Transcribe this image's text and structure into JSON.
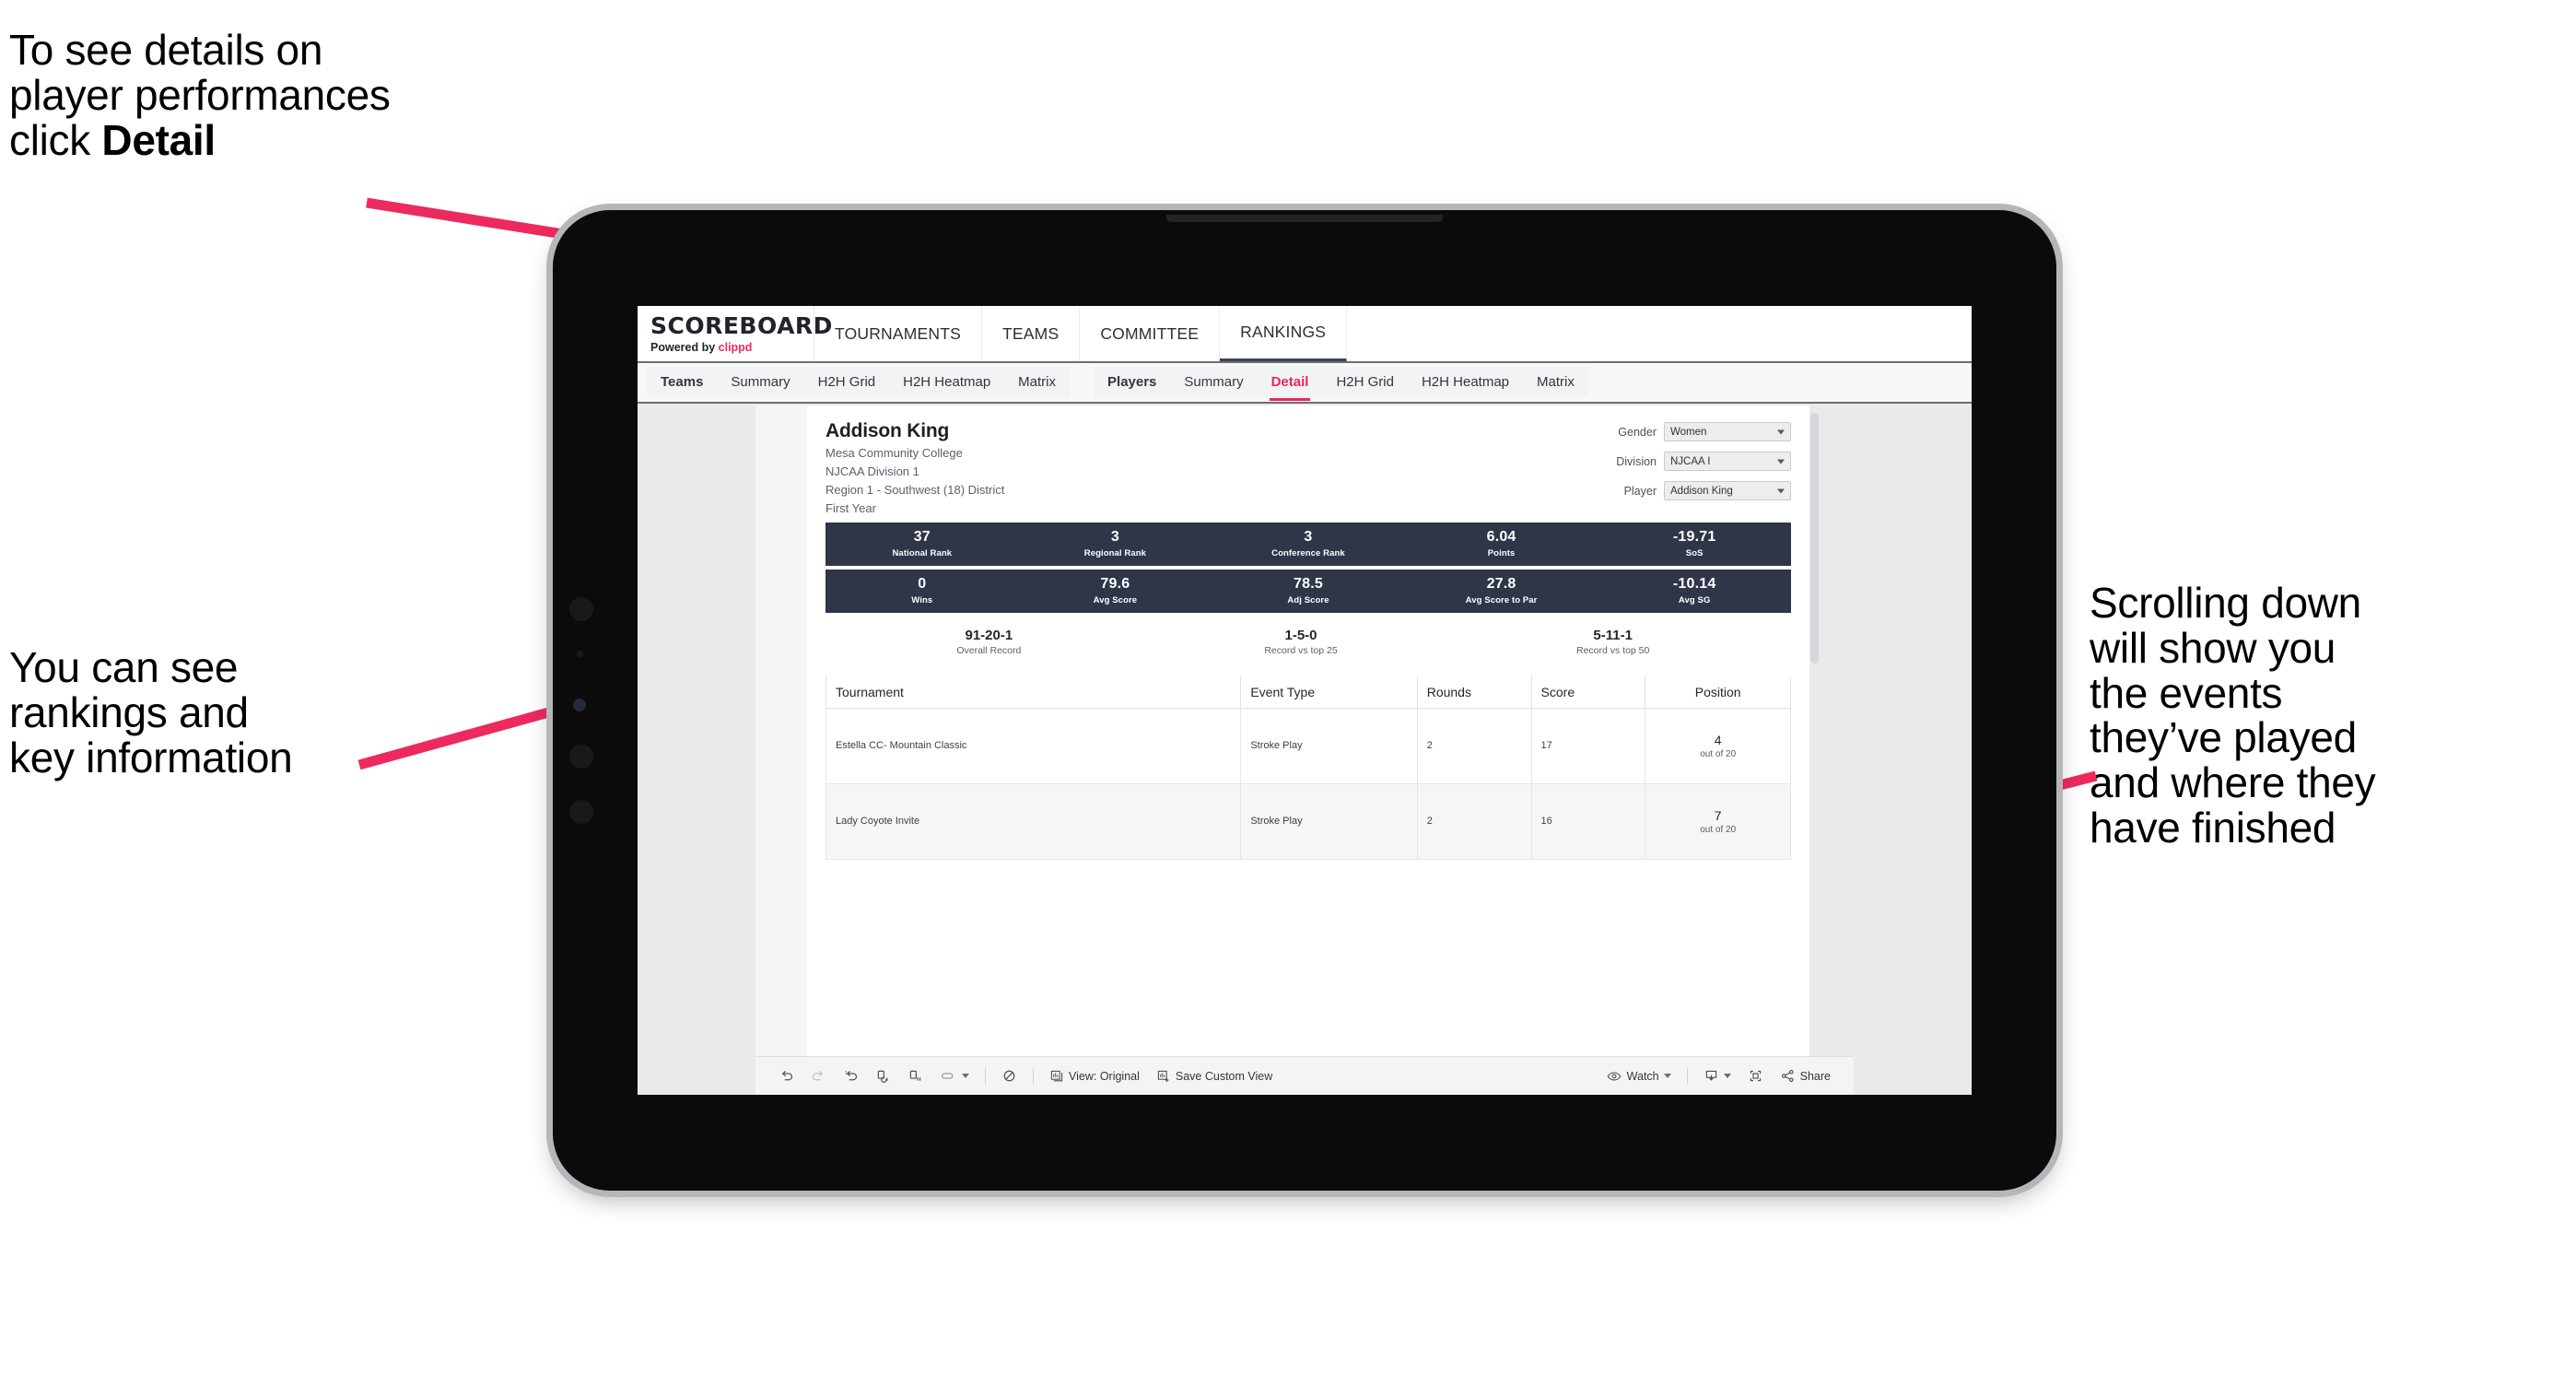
{
  "annotations": {
    "top_left": "To see details on\nplayer performances\nclick ",
    "top_left_bold": "Detail",
    "bottom_left": "You can see\nrankings and\nkey information",
    "right": "Scrolling down\nwill show you\nthe events\nthey’ve played\nand where they\nhave finished"
  },
  "brand": {
    "wordmark": "SCOREBOARD",
    "powered_prefix": "Powered by ",
    "powered_name": "clippd"
  },
  "topnav": [
    {
      "label": "TOURNAMENTS"
    },
    {
      "label": "TEAMS"
    },
    {
      "label": "COMMITTEE"
    },
    {
      "label": "RANKINGS"
    }
  ],
  "subtabs": {
    "teams_group": [
      {
        "label": "Teams",
        "active": false
      },
      {
        "label": "Summary",
        "active": false
      },
      {
        "label": "H2H Grid",
        "active": false
      },
      {
        "label": "H2H Heatmap",
        "active": false
      },
      {
        "label": "Matrix",
        "active": false
      }
    ],
    "players_group": [
      {
        "label": "Players",
        "active": false
      },
      {
        "label": "Summary",
        "active": false
      },
      {
        "label": "Detail",
        "active": true
      },
      {
        "label": "H2H Grid",
        "active": false
      },
      {
        "label": "H2H Heatmap",
        "active": false
      },
      {
        "label": "Matrix",
        "active": false
      }
    ]
  },
  "player": {
    "name": "Addison King",
    "school": "Mesa Community College",
    "division": "NJCAA Division 1",
    "region": "Region 1 - Southwest (18) District",
    "year": "First Year"
  },
  "filters": [
    {
      "label": "Gender",
      "value": "Women"
    },
    {
      "label": "Division",
      "value": "NJCAA I"
    },
    {
      "label": "Player",
      "value": "Addison King"
    }
  ],
  "stats_row_1": [
    {
      "value": "37",
      "label": "National Rank"
    },
    {
      "value": "3",
      "label": "Regional Rank"
    },
    {
      "value": "3",
      "label": "Conference Rank"
    },
    {
      "value": "6.04",
      "label": "Points"
    },
    {
      "value": "-19.71",
      "label": "SoS"
    }
  ],
  "stats_row_2": [
    {
      "value": "0",
      "label": "Wins"
    },
    {
      "value": "79.6",
      "label": "Avg Score"
    },
    {
      "value": "78.5",
      "label": "Adj Score"
    },
    {
      "value": "27.8",
      "label": "Avg Score to Par"
    },
    {
      "value": "-10.14",
      "label": "Avg SG"
    }
  ],
  "records": [
    {
      "value": "91-20-1",
      "label": "Overall Record"
    },
    {
      "value": "1-5-0",
      "label": "Record vs top 25"
    },
    {
      "value": "5-11-1",
      "label": "Record vs top 50"
    }
  ],
  "events_table": {
    "headers": [
      "Tournament",
      "Event Type",
      "Rounds",
      "Score",
      "Position"
    ],
    "rows": [
      {
        "tournament": "Estella CC- Mountain Classic",
        "event_type": "Stroke Play",
        "rounds": "2",
        "score": "17",
        "position": "4",
        "position_sub": "out of 20"
      },
      {
        "tournament": "Lady Coyote Invite",
        "event_type": "Stroke Play",
        "rounds": "2",
        "score": "16",
        "position": "7",
        "position_sub": "out of 20"
      }
    ]
  },
  "toolbar": {
    "view_label": "View: Original",
    "save_label": "Save Custom View",
    "watch_label": "Watch",
    "share_label": "Share"
  },
  "colors": {
    "accent_pink": "#e8295b",
    "stat_bar_navy": "#2f3648",
    "arrow_pink": "#ec2a5e"
  }
}
